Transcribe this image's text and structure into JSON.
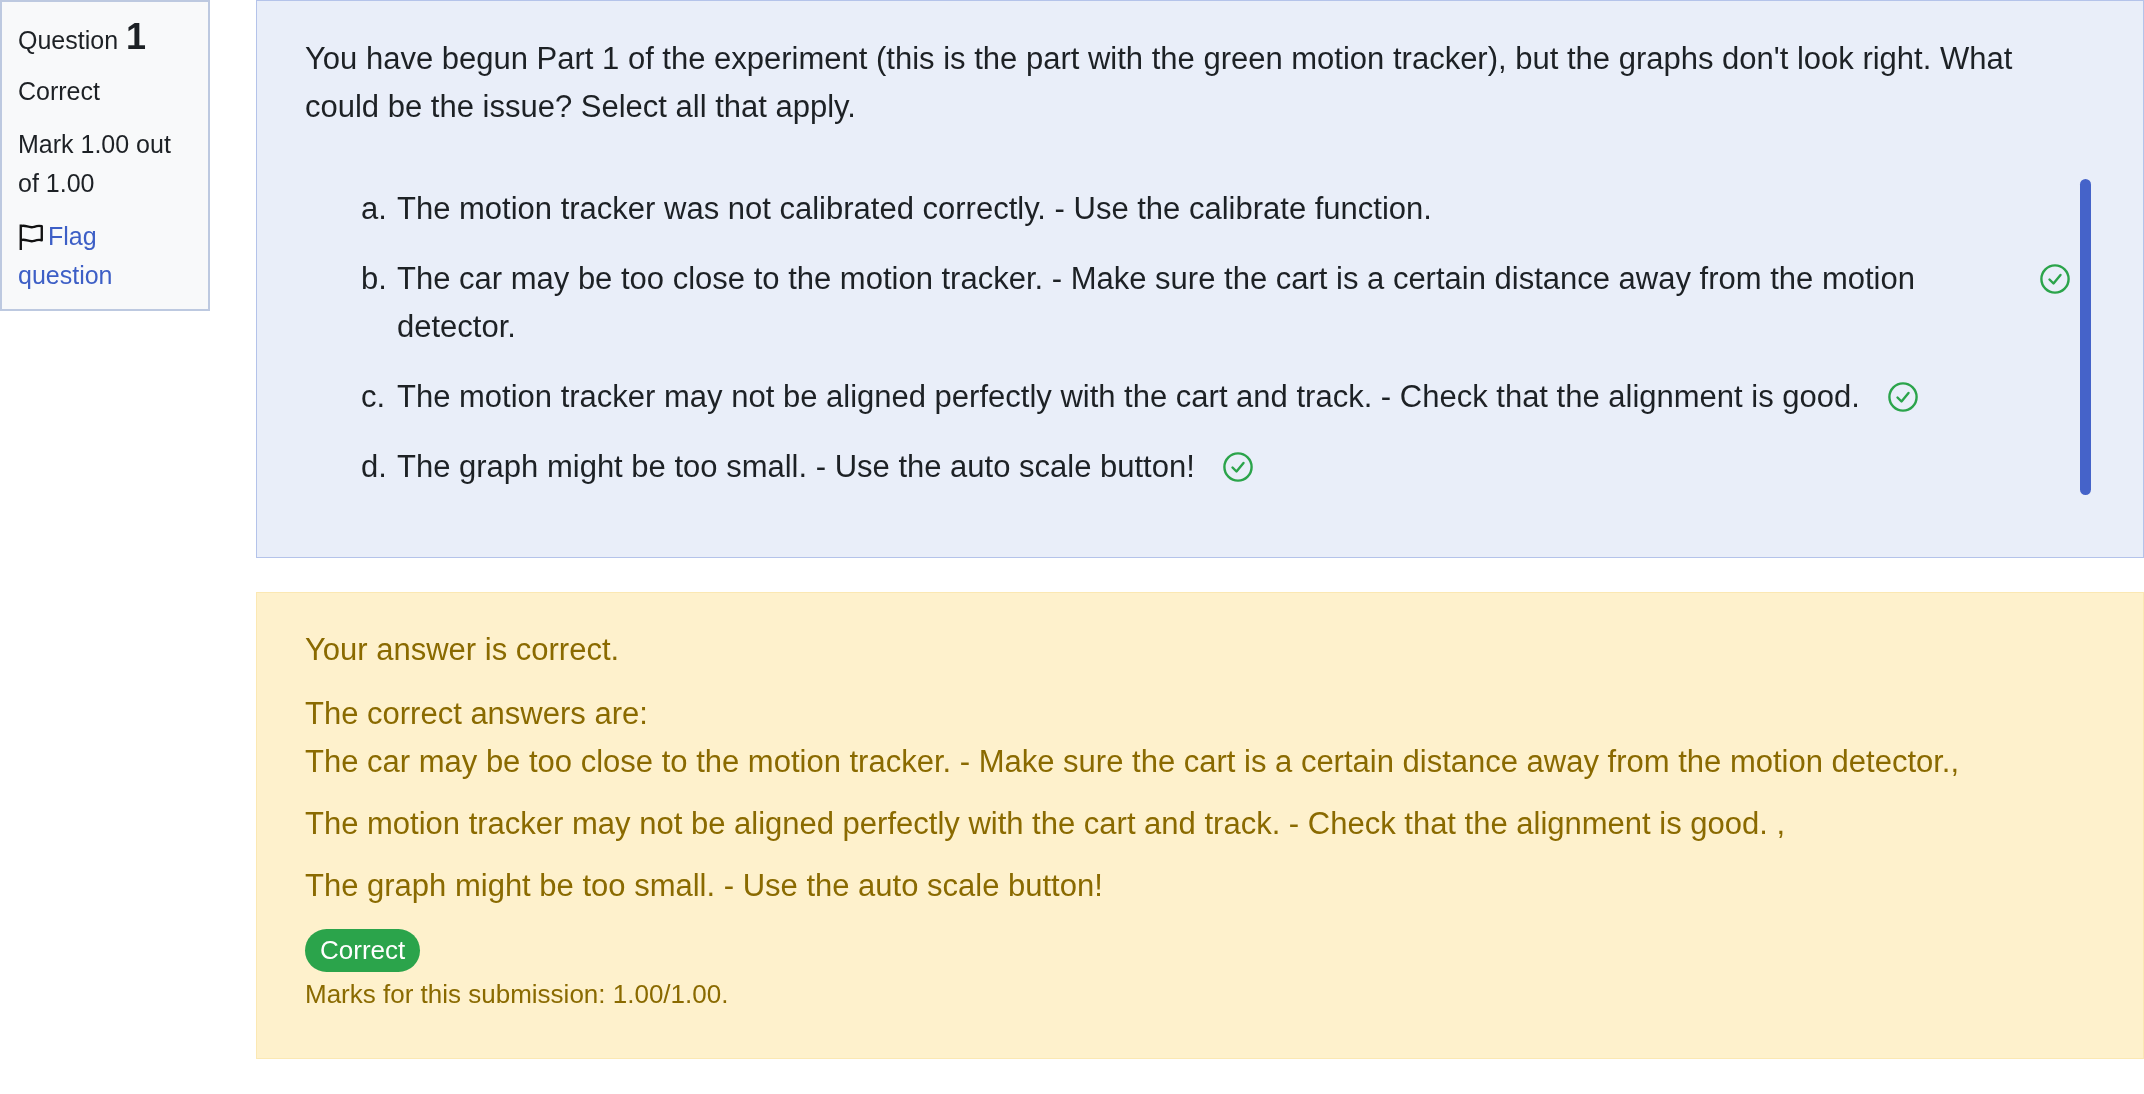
{
  "info": {
    "question_label": "Question",
    "question_number": "1",
    "state": "Correct",
    "grade": "Mark 1.00 out of 1.00",
    "flag_link": "Flag question"
  },
  "question": {
    "text": "You have begun Part 1 of the experiment (this is the part with the green motion tracker), but the graphs don't look right. What could be the issue? Select all that apply.",
    "options": [
      {
        "label": "a.",
        "text": "The motion tracker was not calibrated correctly. - Use the calibrate function.",
        "correct": false
      },
      {
        "label": "b.",
        "text": "The car may be too close to the motion tracker. - Make sure the cart is a certain distance away from the motion detector.",
        "correct": true
      },
      {
        "label": "c.",
        "text": "The motion tracker may not be aligned perfectly with the cart and track. - Check that the alignment is good.",
        "correct": true
      },
      {
        "label": "d.",
        "text": "The graph might be too small. - Use the auto scale button!",
        "correct": true
      }
    ]
  },
  "feedback": {
    "general": "Your answer is correct.",
    "right_answer_heading": "The correct answers are:",
    "right_answers": [
      "The car may be too close to the motion tracker. - Make sure the cart is a certain distance away from the motion detector.,",
      "The motion tracker may not be aligned perfectly with the cart and track. - Check that the alignment is good. ,",
      "The graph might be too small. - Use the auto scale button!"
    ],
    "badge": "Correct",
    "marks": "Marks for this submission: 1.00/1.00."
  }
}
